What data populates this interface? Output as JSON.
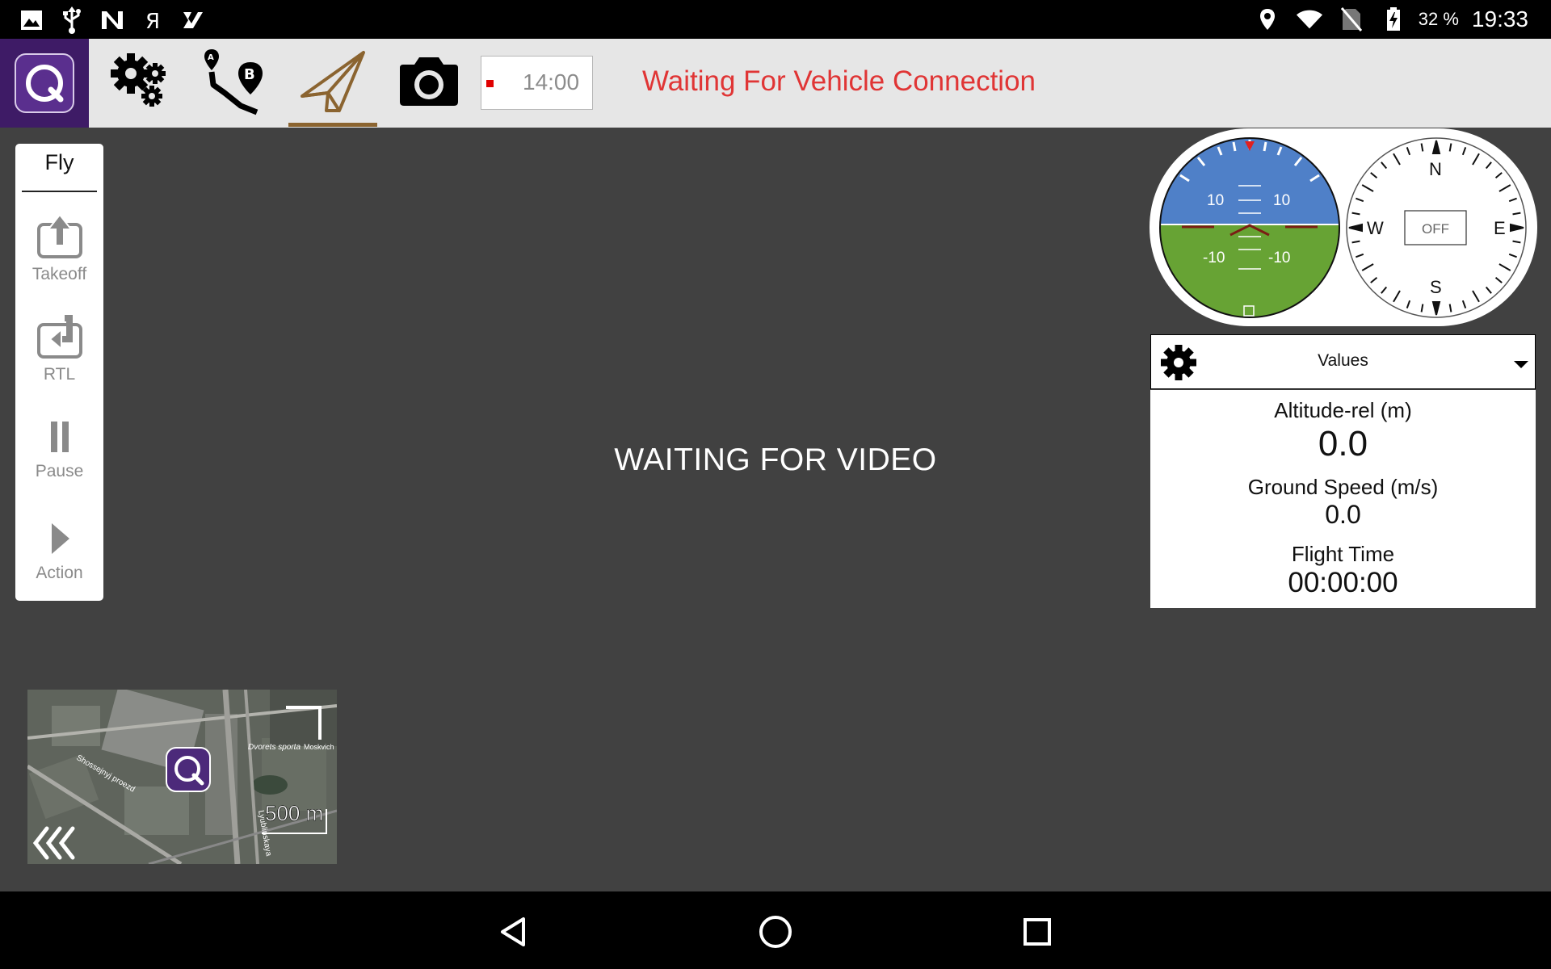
{
  "status_bar": {
    "left_icons": [
      "gallery-icon",
      "usb-icon",
      "n-app-icon",
      "yandex-icon",
      "tasks-check-icon"
    ],
    "right_icons": [
      "location-icon",
      "wifi-icon",
      "no-sim-icon",
      "battery-charging-icon"
    ],
    "battery": "32 %",
    "clock": "19:33"
  },
  "toolbar": {
    "logo_icon": "qgc-logo-icon",
    "buttons": [
      {
        "name": "settings",
        "icon": "gears-icon"
      },
      {
        "name": "plan",
        "icon": "plan-route-icon"
      },
      {
        "name": "fly",
        "icon": "paper-plane-icon",
        "active": true
      },
      {
        "name": "camera",
        "icon": "camera-icon"
      }
    ],
    "timer": "14:00",
    "connection_status": "Waiting For Vehicle Connection",
    "connection_color": "#e03535",
    "active_color": "#8b6430"
  },
  "fly_panel": {
    "title": "Fly",
    "items": [
      {
        "label": "Takeoff",
        "icon": "takeoff-icon"
      },
      {
        "label": "RTL",
        "icon": "rtl-icon"
      },
      {
        "label": "Pause",
        "icon": "pause-icon"
      },
      {
        "label": "Action",
        "icon": "play-icon"
      }
    ]
  },
  "video": {
    "message": "WAITING FOR VIDEO"
  },
  "instruments": {
    "attitude": {
      "pitch_labels_top": [
        "10",
        "10"
      ],
      "pitch_labels_bottom": [
        "-10",
        "-10"
      ]
    },
    "compass": {
      "n": "N",
      "e": "E",
      "s": "S",
      "w": "W",
      "heading_display": "OFF"
    }
  },
  "values_panel": {
    "title": "Values",
    "rows": [
      {
        "label": "Altitude-rel (m)",
        "value": "0.0"
      },
      {
        "label": "Ground Speed (m/s)",
        "value": "0.0"
      },
      {
        "label": "Flight Time",
        "value": "00:00:00"
      }
    ]
  },
  "minimap": {
    "labels": [
      "Dvorets sporta",
      "Moskvich",
      "Shossejnyj proezd",
      "Lyublinskaya"
    ],
    "scale": "500 m",
    "collapse_icon": "chevrons-left-icon"
  },
  "nav_bar": {
    "buttons": [
      "back-icon",
      "home-icon",
      "recents-icon"
    ]
  }
}
